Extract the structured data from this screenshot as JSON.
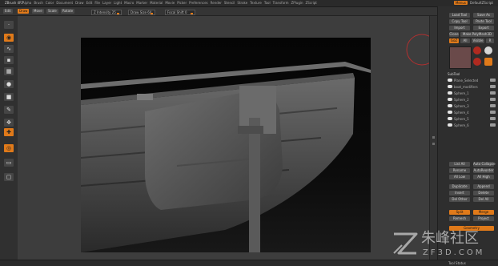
{
  "app": {
    "title": "ZBrush 4R7"
  },
  "menubar": {
    "menus": [
      "Alpha",
      "Brush",
      "Color",
      "Document",
      "Draw",
      "Edit",
      "File",
      "Layer",
      "Light",
      "Macro",
      "Marker",
      "Material",
      "Movie",
      "Picker",
      "Preferences",
      "Render",
      "Stencil",
      "Stroke",
      "Texture",
      "Tool",
      "Transform",
      "ZPlugin",
      "ZScript"
    ],
    "right": {
      "badge": "Menus",
      "layout": "DefaultZScript"
    }
  },
  "toolbar": {
    "buttons": [
      {
        "label": "Edit",
        "on": false
      },
      {
        "label": "Draw",
        "on": true
      },
      {
        "label": "Move",
        "on": false
      },
      {
        "label": "Scale",
        "on": false
      },
      {
        "label": "Rotate",
        "on": false
      }
    ],
    "sliders": [
      {
        "label": "Z Intensity 25"
      },
      {
        "label": "Draw Size 64"
      },
      {
        "label": "Focal Shift 0"
      }
    ]
  },
  "left_tools": [
    {
      "label": "Dots",
      "on": false
    },
    {
      "label": "Std",
      "on": true
    },
    {
      "label": "Alpha",
      "on": false
    },
    {
      "label": "Tex",
      "on": false
    },
    {
      "label": "Mat",
      "on": false
    },
    {
      "label": "Color",
      "on": false
    },
    {
      "label": "Persp",
      "on": false
    },
    {
      "label": "Floor",
      "on": false
    },
    {
      "label": "Local",
      "on": false
    },
    {
      "label": "Frame",
      "on": false
    },
    {
      "label": "Move",
      "on": true
    }
  ],
  "viewport": {
    "colors": {
      "hull": "#555555",
      "rudder": "#5f5f5f",
      "background": "#050505"
    }
  },
  "right_panel": {
    "top_buttons": [
      "Load Tool",
      "Save As",
      "Copy Tool",
      "Paste Tool",
      "Import",
      "Export",
      "Clone",
      "Make PolyMesh3D",
      "GoZ",
      "All",
      "Visible",
      "R"
    ],
    "subtool_header": "SubTool",
    "subtools": [
      "Plane_Selected",
      "boat_modifiers",
      "Sphere_1",
      "Sphere_2",
      "Sphere_3",
      "Sphere_4",
      "Sphere_5",
      "Sphere_6"
    ],
    "action_buttons": [
      "List All",
      "Auto Collapse",
      "Rename",
      "AutoReorder",
      "All Low",
      "All High",
      "Duplicate",
      "Append",
      "Insert",
      "Delete",
      "Del Other",
      "Del All",
      "Split",
      "Merge",
      "Remesh",
      "Project"
    ],
    "bottom_label": "Geometry"
  },
  "statusbar": {
    "left": "",
    "right": "Tool Status"
  },
  "watermark": {
    "brand": "朱峰社区",
    "url": "ZF3D.COM",
    "color": "#a8a8a8"
  }
}
